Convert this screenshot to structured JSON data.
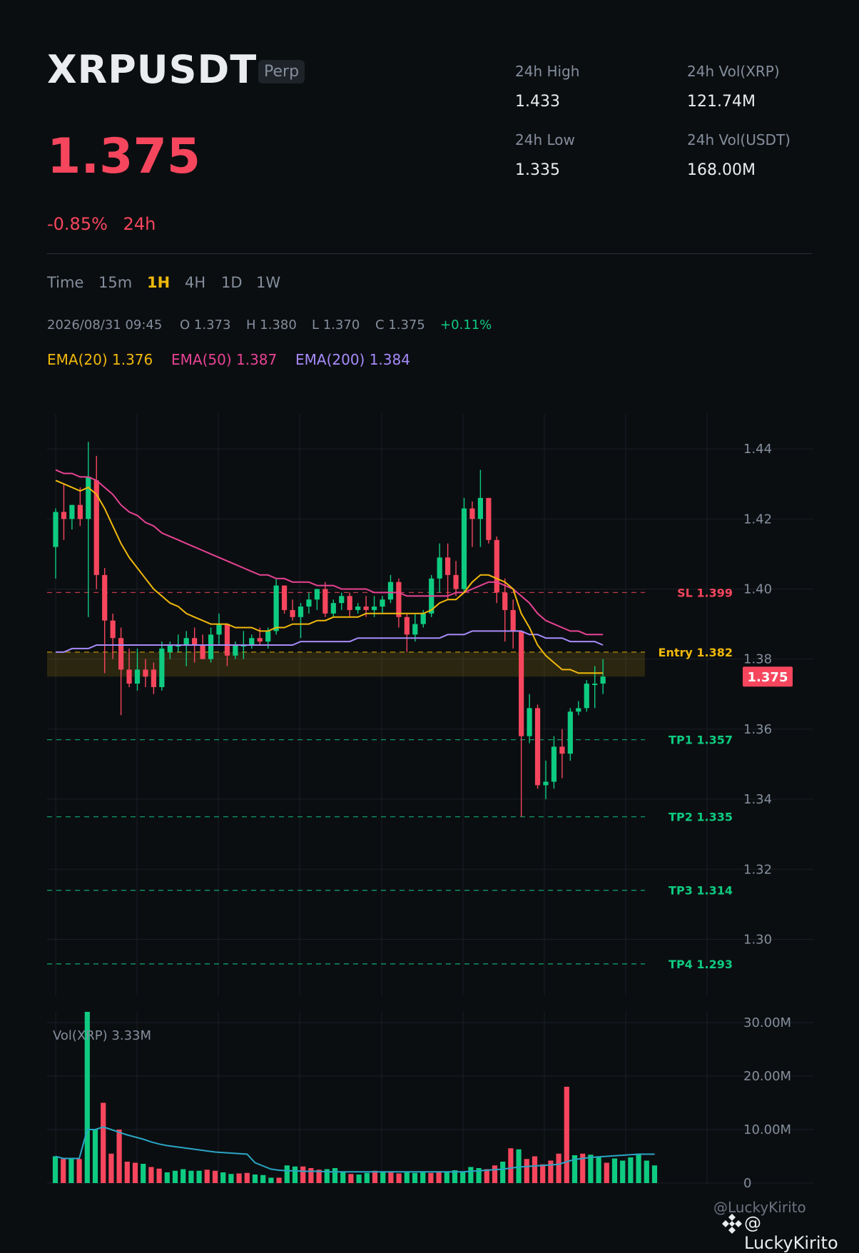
{
  "header": {
    "symbol": "XRPUSDT",
    "badge": "Perp",
    "price": "1.375",
    "change_pct": "-0.85%",
    "change_period": "24h",
    "stats": {
      "high_label": "24h High",
      "high_value": "1.433",
      "low_label": "24h Low",
      "low_value": "1.335",
      "vol_base_label": "24h Vol(XRP)",
      "vol_base_value": "121.74M",
      "vol_quote_label": "24h Vol(USDT)",
      "vol_quote_value": "168.00M"
    }
  },
  "timeframes": [
    "Time",
    "15m",
    "1H",
    "4H",
    "1D",
    "1W"
  ],
  "active_timeframe": "1H",
  "ohlc": {
    "datetime": "2026/08/31 09:45",
    "o": "O 1.373",
    "h": "H 1.380",
    "l": "L 1.370",
    "c": "C 1.375",
    "chg": "+0.11%"
  },
  "ema_legend": [
    {
      "label": "EMA(20) 1.376",
      "color": "#f0b90b"
    },
    {
      "label": "EMA(50) 1.387",
      "color": "#e84393"
    },
    {
      "label": "EMA(200) 1.384",
      "color": "#a78bfa"
    }
  ],
  "colors": {
    "up": "#0ecb81",
    "down": "#f6465d",
    "bg": "#0b0e11",
    "grid": "#1a1f26",
    "axis_text": "#848e9c",
    "entry": "#f0b90b",
    "sl": "#f6465d",
    "tp": "#0ecb81",
    "vol_ma": "#2ba6c6"
  },
  "chart_data": [
    {
      "type": "candlestick",
      "title": "",
      "y_ticks": [
        "1.30",
        "1.32",
        "1.34",
        "1.36",
        "1.38",
        "1.40",
        "1.42",
        "1.44"
      ],
      "ylim": [
        1.284,
        1.45
      ],
      "last_price_label": "1.375",
      "candles": [
        [
          1.412,
          1.423,
          1.403,
          1.422
        ],
        [
          1.422,
          1.43,
          1.414,
          1.42
        ],
        [
          1.42,
          1.424,
          1.417,
          1.424
        ],
        [
          1.424,
          1.429,
          1.418,
          1.42
        ],
        [
          1.42,
          1.442,
          1.392,
          1.432
        ],
        [
          1.431,
          1.438,
          1.4,
          1.404
        ],
        [
          1.404,
          1.406,
          1.376,
          1.391
        ],
        [
          1.391,
          1.393,
          1.38,
          1.386
        ],
        [
          1.386,
          1.389,
          1.364,
          1.377
        ],
        [
          1.377,
          1.383,
          1.372,
          1.373
        ],
        [
          1.373,
          1.383,
          1.371,
          1.377
        ],
        [
          1.377,
          1.38,
          1.372,
          1.375
        ],
        [
          1.377,
          1.379,
          1.37,
          1.372
        ],
        [
          1.372,
          1.385,
          1.371,
          1.383
        ],
        [
          1.382,
          1.385,
          1.38,
          1.384
        ],
        [
          1.384,
          1.387,
          1.382,
          1.384
        ],
        [
          1.384,
          1.388,
          1.378,
          1.386
        ],
        [
          1.386,
          1.389,
          1.379,
          1.384
        ],
        [
          1.384,
          1.387,
          1.38,
          1.38
        ],
        [
          1.38,
          1.389,
          1.379,
          1.387
        ],
        [
          1.387,
          1.393,
          1.384,
          1.39
        ],
        [
          1.39,
          1.39,
          1.378,
          1.381
        ],
        [
          1.381,
          1.385,
          1.38,
          1.384
        ],
        [
          1.384,
          1.388,
          1.38,
          1.384
        ],
        [
          1.384,
          1.387,
          1.383,
          1.386
        ],
        [
          1.386,
          1.389,
          1.384,
          1.385
        ],
        [
          1.385,
          1.389,
          1.383,
          1.388
        ],
        [
          1.388,
          1.403,
          1.387,
          1.401
        ],
        [
          1.401,
          1.401,
          1.393,
          1.394
        ],
        [
          1.394,
          1.397,
          1.391,
          1.392
        ],
        [
          1.392,
          1.396,
          1.386,
          1.395
        ],
        [
          1.395,
          1.399,
          1.393,
          1.397
        ],
        [
          1.397,
          1.4,
          1.394,
          1.4
        ],
        [
          1.4,
          1.402,
          1.392,
          1.393
        ],
        [
          1.393,
          1.397,
          1.392,
          1.396
        ],
        [
          1.396,
          1.399,
          1.394,
          1.398
        ],
        [
          1.398,
          1.399,
          1.392,
          1.394
        ],
        [
          1.394,
          1.396,
          1.393,
          1.395
        ],
        [
          1.395,
          1.398,
          1.392,
          1.394
        ],
        [
          1.394,
          1.398,
          1.392,
          1.395
        ],
        [
          1.395,
          1.398,
          1.393,
          1.397
        ],
        [
          1.397,
          1.404,
          1.396,
          1.402
        ],
        [
          1.402,
          1.403,
          1.389,
          1.392
        ],
        [
          1.392,
          1.393,
          1.382,
          1.387
        ],
        [
          1.387,
          1.393,
          1.385,
          1.39
        ],
        [
          1.39,
          1.394,
          1.389,
          1.393
        ],
        [
          1.393,
          1.404,
          1.392,
          1.403
        ],
        [
          1.403,
          1.413,
          1.399,
          1.409
        ],
        [
          1.409,
          1.413,
          1.397,
          1.404
        ],
        [
          1.404,
          1.408,
          1.398,
          1.4
        ],
        [
          1.4,
          1.426,
          1.399,
          1.423
        ],
        [
          1.423,
          1.425,
          1.412,
          1.42
        ],
        [
          1.42,
          1.434,
          1.412,
          1.426
        ],
        [
          1.426,
          1.426,
          1.413,
          1.414
        ],
        [
          1.414,
          1.415,
          1.396,
          1.399
        ],
        [
          1.399,
          1.403,
          1.385,
          1.394
        ],
        [
          1.394,
          1.397,
          1.383,
          1.388
        ],
        [
          1.388,
          1.388,
          1.335,
          1.358
        ],
        [
          1.358,
          1.37,
          1.356,
          1.366
        ],
        [
          1.366,
          1.367,
          1.343,
          1.344
        ],
        [
          1.344,
          1.351,
          1.34,
          1.345
        ],
        [
          1.345,
          1.358,
          1.343,
          1.355
        ],
        [
          1.355,
          1.36,
          1.346,
          1.353
        ],
        [
          1.353,
          1.366,
          1.351,
          1.365
        ],
        [
          1.365,
          1.368,
          1.364,
          1.366
        ],
        [
          1.366,
          1.374,
          1.365,
          1.373
        ],
        [
          1.373,
          1.378,
          1.366,
          1.373
        ],
        [
          1.373,
          1.38,
          1.37,
          1.375
        ]
      ],
      "ema20": [
        1.431,
        1.43,
        1.429,
        1.428,
        1.429,
        1.427,
        1.423,
        1.418,
        1.413,
        1.409,
        1.406,
        1.403,
        1.4,
        1.398,
        1.396,
        1.395,
        1.393,
        1.392,
        1.391,
        1.39,
        1.39,
        1.39,
        1.389,
        1.389,
        1.389,
        1.388,
        1.388,
        1.389,
        1.389,
        1.39,
        1.39,
        1.39,
        1.391,
        1.391,
        1.392,
        1.392,
        1.392,
        1.392,
        1.393,
        1.393,
        1.393,
        1.393,
        1.393,
        1.393,
        1.393,
        1.393,
        1.394,
        1.396,
        1.397,
        1.397,
        1.399,
        1.402,
        1.404,
        1.404,
        1.403,
        1.402,
        1.4,
        1.393,
        1.389,
        1.384,
        1.381,
        1.379,
        1.377,
        1.377,
        1.376,
        1.376,
        1.376,
        1.376
      ],
      "ema50": [
        1.434,
        1.433,
        1.433,
        1.432,
        1.432,
        1.431,
        1.429,
        1.427,
        1.424,
        1.422,
        1.421,
        1.419,
        1.418,
        1.416,
        1.415,
        1.414,
        1.413,
        1.412,
        1.411,
        1.41,
        1.409,
        1.408,
        1.407,
        1.406,
        1.405,
        1.404,
        1.404,
        1.403,
        1.403,
        1.402,
        1.402,
        1.402,
        1.401,
        1.401,
        1.401,
        1.4,
        1.4,
        1.4,
        1.4,
        1.399,
        1.399,
        1.399,
        1.399,
        1.398,
        1.398,
        1.398,
        1.398,
        1.398,
        1.398,
        1.399,
        1.399,
        1.4,
        1.401,
        1.402,
        1.402,
        1.401,
        1.4,
        1.398,
        1.396,
        1.393,
        1.391,
        1.39,
        1.389,
        1.388,
        1.388,
        1.387,
        1.387,
        1.387
      ],
      "ema200": [
        1.382,
        1.382,
        1.383,
        1.383,
        1.383,
        1.384,
        1.384,
        1.384,
        1.384,
        1.384,
        1.384,
        1.384,
        1.384,
        1.384,
        1.384,
        1.384,
        1.384,
        1.384,
        1.384,
        1.384,
        1.384,
        1.384,
        1.384,
        1.384,
        1.384,
        1.384,
        1.384,
        1.384,
        1.384,
        1.384,
        1.385,
        1.385,
        1.385,
        1.385,
        1.385,
        1.385,
        1.385,
        1.386,
        1.386,
        1.386,
        1.386,
        1.386,
        1.386,
        1.386,
        1.386,
        1.386,
        1.386,
        1.386,
        1.387,
        1.387,
        1.387,
        1.388,
        1.388,
        1.388,
        1.388,
        1.388,
        1.388,
        1.388,
        1.387,
        1.387,
        1.386,
        1.386,
        1.386,
        1.385,
        1.385,
        1.385,
        1.385,
        1.384
      ],
      "levels": [
        {
          "label": "SL 1.399",
          "value": 1.399,
          "kind": "sl"
        },
        {
          "label": "Entry 1.382",
          "value": 1.382,
          "kind": "entry",
          "zone": [
            1.375,
            1.382
          ]
        },
        {
          "label": "TP1 1.357",
          "value": 1.357,
          "kind": "tp"
        },
        {
          "label": "TP2 1.335",
          "value": 1.335,
          "kind": "tp"
        },
        {
          "label": "TP3 1.314",
          "value": 1.314,
          "kind": "tp"
        },
        {
          "label": "TP4 1.293",
          "value": 1.293,
          "kind": "tp"
        }
      ]
    },
    {
      "type": "bar",
      "title": "Vol(XRP) 3.33M",
      "y_ticks": [
        "0",
        "10.00M",
        "20.00M",
        "30.00M"
      ],
      "ylim": [
        0,
        32
      ],
      "volumes": [
        5.0,
        4.5,
        4.5,
        4.5,
        32.0,
        10.0,
        15.0,
        5.5,
        10.0,
        4.0,
        3.8,
        3.6,
        3.0,
        2.7,
        2.0,
        2.3,
        2.6,
        2.3,
        2.3,
        2.5,
        2.3,
        2.0,
        1.7,
        1.8,
        1.9,
        1.6,
        1.5,
        1.0,
        1.0,
        3.3,
        3.1,
        3.1,
        2.8,
        2.5,
        2.6,
        2.8,
        2.2,
        1.7,
        1.6,
        1.9,
        2.3,
        2.2,
        2.1,
        1.8,
        2.1,
        1.9,
        2.1,
        1.9,
        2.2,
        2.0,
        2.4,
        2.1,
        3.0,
        2.8,
        2.6,
        3.3,
        4.0,
        6.5,
        6.3,
        4.5,
        5.0,
        3.5,
        4.2,
        5.5,
        18.0,
        5.2,
        5.5,
        5.3,
        5.0,
        3.8,
        4.6,
        4.2,
        4.8,
        5.5,
        4.2,
        3.3
      ],
      "vol_ma": [
        5.0,
        4.6,
        4.6,
        4.6,
        10.0,
        10.0,
        10.5,
        10.0,
        9.5,
        9.0,
        8.6,
        8.2,
        7.7,
        7.3,
        7.0,
        6.8,
        6.6,
        6.4,
        6.2,
        6.0,
        5.8,
        5.7,
        5.6,
        5.5,
        5.4,
        3.8,
        3.2,
        2.6,
        2.4,
        2.3,
        2.3,
        2.2,
        2.2,
        2.2,
        2.1,
        2.1,
        2.1,
        2.1,
        2.1,
        2.1,
        2.1,
        2.1,
        2.1,
        2.1,
        2.1,
        2.1,
        2.1,
        2.1,
        2.1,
        2.1,
        2.1,
        2.1,
        2.2,
        2.3,
        2.4,
        2.5,
        2.6,
        2.8,
        3.0,
        3.1,
        3.2,
        3.3,
        3.4,
        3.5,
        4.0,
        4.4,
        4.6,
        4.8,
        4.9,
        5.0,
        5.1,
        5.2,
        5.3,
        5.4,
        5.4,
        5.4
      ]
    }
  ],
  "footer": {
    "watermark": "@LuckyKirito",
    "brand": "@ LuckyKirito"
  }
}
